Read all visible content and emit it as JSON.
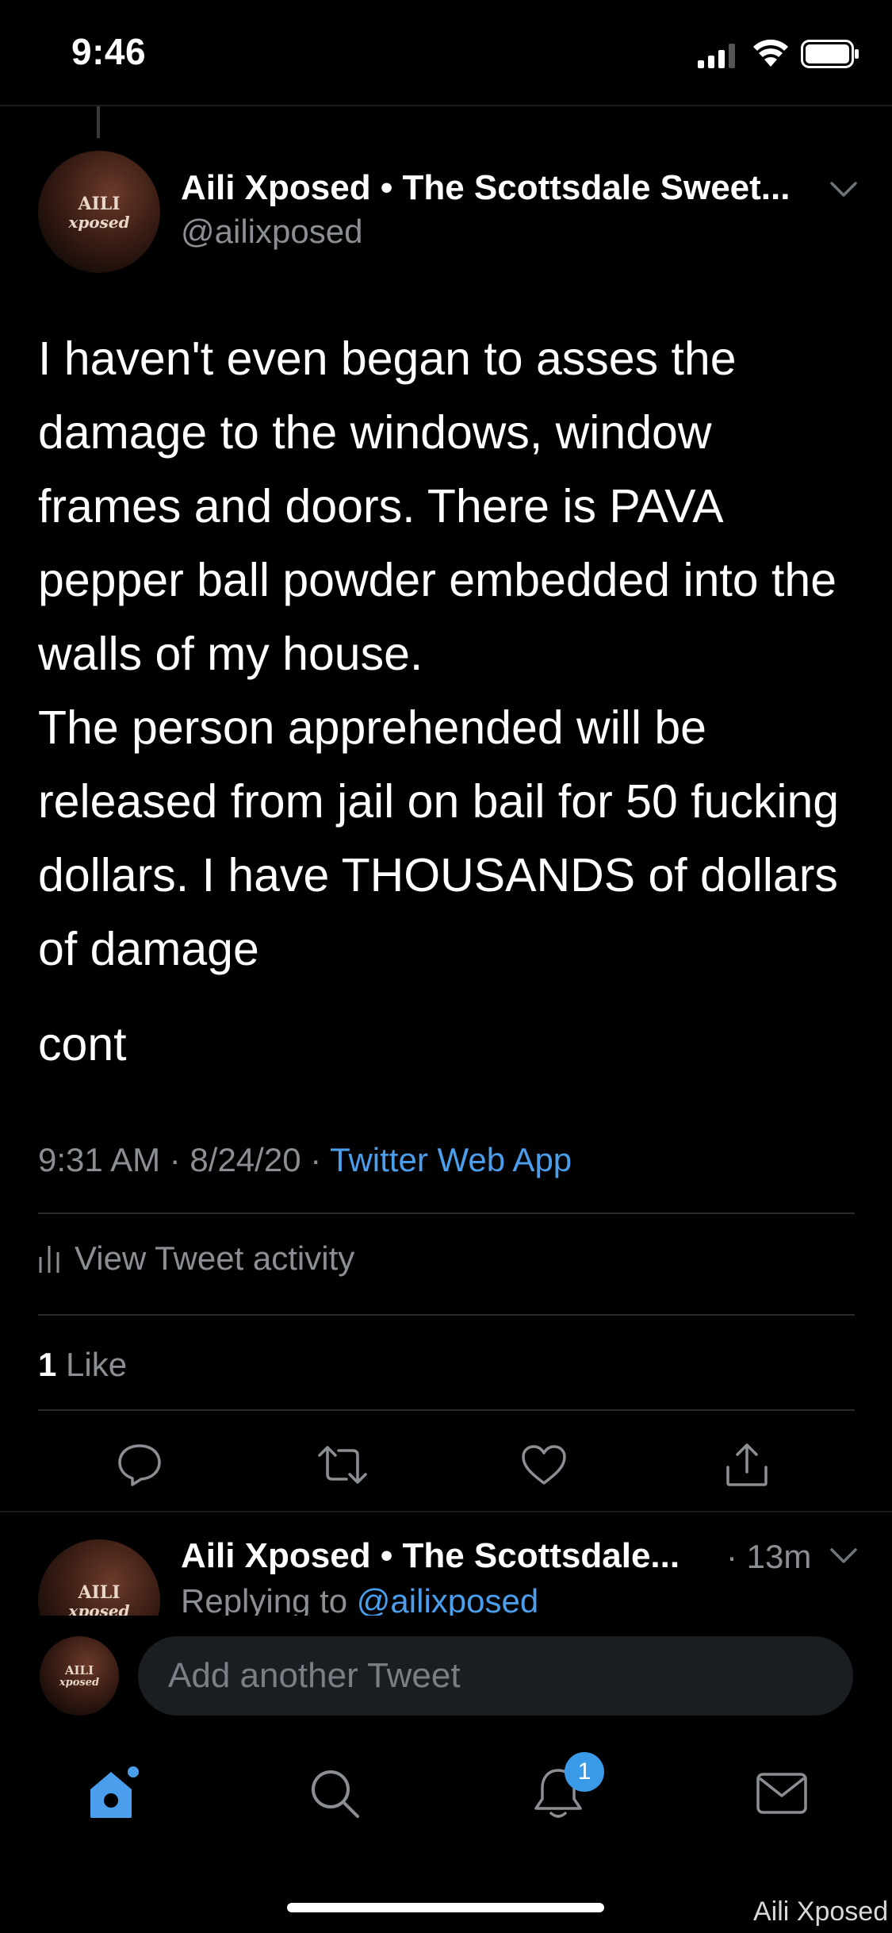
{
  "status_bar": {
    "time": "9:46"
  },
  "tweet": {
    "author_name": "Aili Xposed • The Scottsdale Sweet...",
    "author_handle": "@ailixposed",
    "avatar_text_line1": "AILI",
    "avatar_text_line2": "xposed",
    "text": "I haven't even began to asses the damage to the windows, window frames and doors. There is PAVA pepper ball powder embedded into the walls of my house.\nThe person apprehended will be released from jail on bail for 50 fucking dollars. I have THOUSANDS of dollars of damage",
    "text_cont": "cont",
    "time": "9:31 AM · 8/24/20 · ",
    "source": "Twitter Web App",
    "activity_label": "View Tweet activity",
    "like_count": "1",
    "like_label": " Like"
  },
  "reply": {
    "author_name": "Aili Xposed • The Scottsdale...",
    "time": "· 13m",
    "replying_prefix": "Replying to ",
    "replying_handle": "@ailixposed"
  },
  "compose": {
    "placeholder": "Add another Tweet"
  },
  "tab_bar": {
    "notifications_badge": "1"
  },
  "watermark": "Aili Xposed",
  "colors": {
    "link": "#4a9eec",
    "muted": "#8b8f94",
    "accent": "#3b9ae8",
    "background": "#000000"
  }
}
